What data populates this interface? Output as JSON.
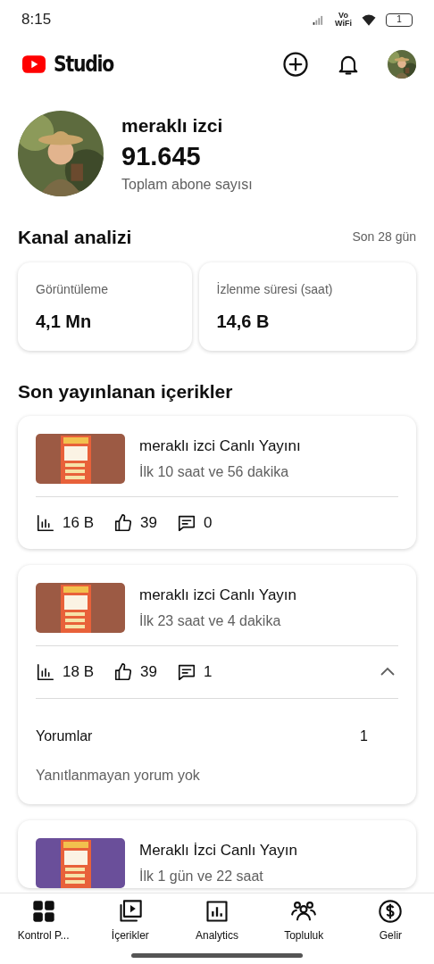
{
  "status_bar": {
    "time": "8:15",
    "call_label_top": "Vo",
    "call_label_bottom": "WiFi",
    "battery": "1"
  },
  "header": {
    "logo_text": "Studio"
  },
  "channel": {
    "name": "meraklı izci",
    "subscribers": "91.645",
    "subscribers_label": "Toplam abone sayısı"
  },
  "analytics": {
    "title": "Kanal analizi",
    "period": "Son 28 gün",
    "metrics": [
      {
        "label": "Görüntüleme",
        "value": "4,1 Mn"
      },
      {
        "label": "İzlenme süresi (saat)",
        "value": "14,6 B"
      }
    ]
  },
  "recent": {
    "title": "Son yayınlanan içerikler",
    "items": [
      {
        "title": "meraklı izci Canlı Yayını",
        "subtitle": "İlk 10 saat ve 56 dakika",
        "color": "#9c5a44",
        "views": "16 B",
        "likes": "39",
        "comments": "0",
        "expanded": false
      },
      {
        "title": "meraklı izci Canlı Yayın",
        "subtitle": "İlk 23 saat ve 4 dakika",
        "color": "#9c5a44",
        "views": "18 B",
        "likes": "39",
        "comments": "1",
        "expanded": true,
        "details": {
          "label": "Yorumlar",
          "count": "1",
          "note": "Yanıtlanmayan yorum yok"
        }
      },
      {
        "title": "Meraklı İzci Canlı Yayın",
        "subtitle": "İlk 1 gün ve 22 saat",
        "color": "#6a4f9a",
        "expanded": false
      }
    ]
  },
  "bottom_nav": [
    {
      "label": "Kontrol P...",
      "selected": true
    },
    {
      "label": "İçerikler",
      "selected": false
    },
    {
      "label": "Analytics",
      "selected": false
    },
    {
      "label": "Topluluk",
      "selected": false
    },
    {
      "label": "Gelir",
      "selected": false
    }
  ]
}
